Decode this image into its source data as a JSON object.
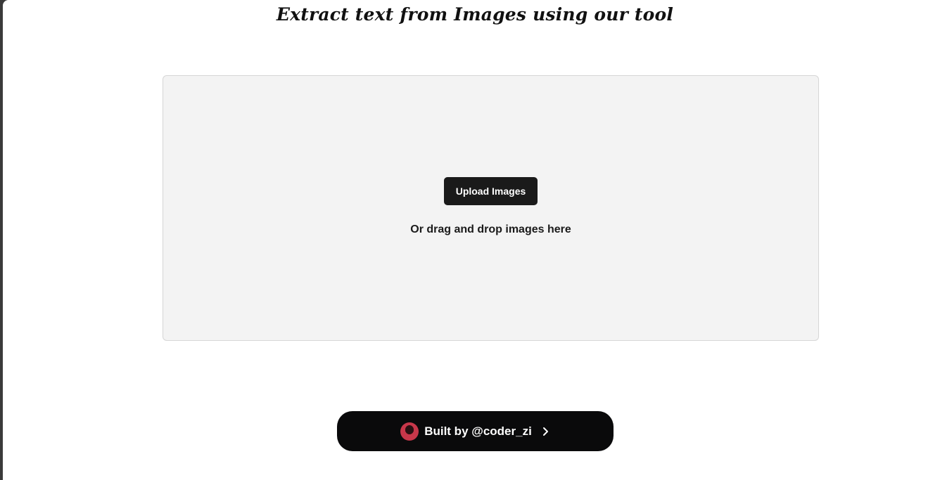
{
  "header": {
    "title": "Extract text from Images using our tool"
  },
  "dropzone": {
    "upload_label": "Upload Images",
    "hint": "Or drag and drop images here"
  },
  "footer": {
    "built_by_label": "Built by @coder_zi",
    "avatar_icon": "avatar-icon",
    "arrow_icon": "chevron-right-icon"
  },
  "colors": {
    "button_bg": "#1a1a1a",
    "dropzone_bg": "#f3f3f3",
    "badge_bg": "#0a0a0b"
  }
}
